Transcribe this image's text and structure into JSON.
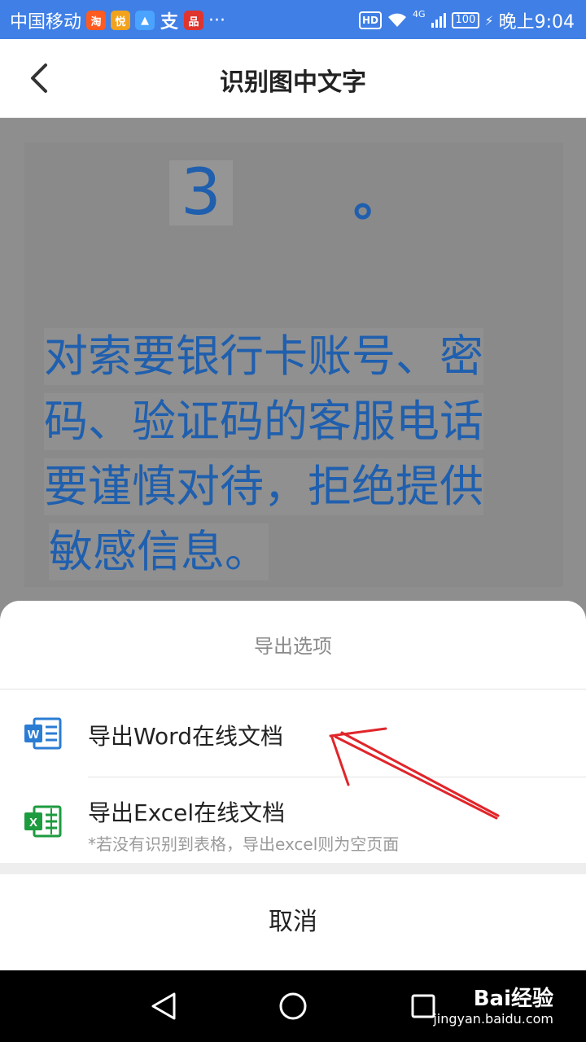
{
  "status_bar": {
    "carrier": "中国移动",
    "app_icons": [
      {
        "glyph": "淘",
        "color": "#ff5a1f"
      },
      {
        "glyph": "悦",
        "color": "#f2a21d"
      },
      {
        "glyph": "▲",
        "color": "#4aa3ff"
      },
      {
        "glyph": "支",
        "color": "#3f7fe6"
      },
      {
        "glyph": "品",
        "color": "#e0342e"
      }
    ],
    "more": "···",
    "hd": "HD",
    "network": "4G",
    "battery": "100",
    "time": "晚上9:04"
  },
  "header": {
    "title": "识别图中文字",
    "back_icon": "chevron-left-icon"
  },
  "ocr": {
    "number": "3",
    "period": "。",
    "lines": [
      "对索要银行卡账号、密",
      "码、验证码的客服电话",
      "要谨慎对待，拒绝提供",
      "敏感信息。"
    ]
  },
  "sheet": {
    "title": "导出选项",
    "options": [
      {
        "label": "导出Word在线文档",
        "icon": "word-icon",
        "icon_letter": "W",
        "color": "#2b7cd3"
      },
      {
        "label": "导出Excel在线文档",
        "sub": "*若没有识别到表格，导出excel则为空页面",
        "icon": "excel-icon",
        "icon_letter": "X",
        "color": "#1d9b3f"
      }
    ],
    "cancel": "取消"
  },
  "annotation": {
    "arrow_color": "#e0262b"
  },
  "watermark": {
    "brand": "Bai经验",
    "url": "jingyan.baidu.com"
  }
}
